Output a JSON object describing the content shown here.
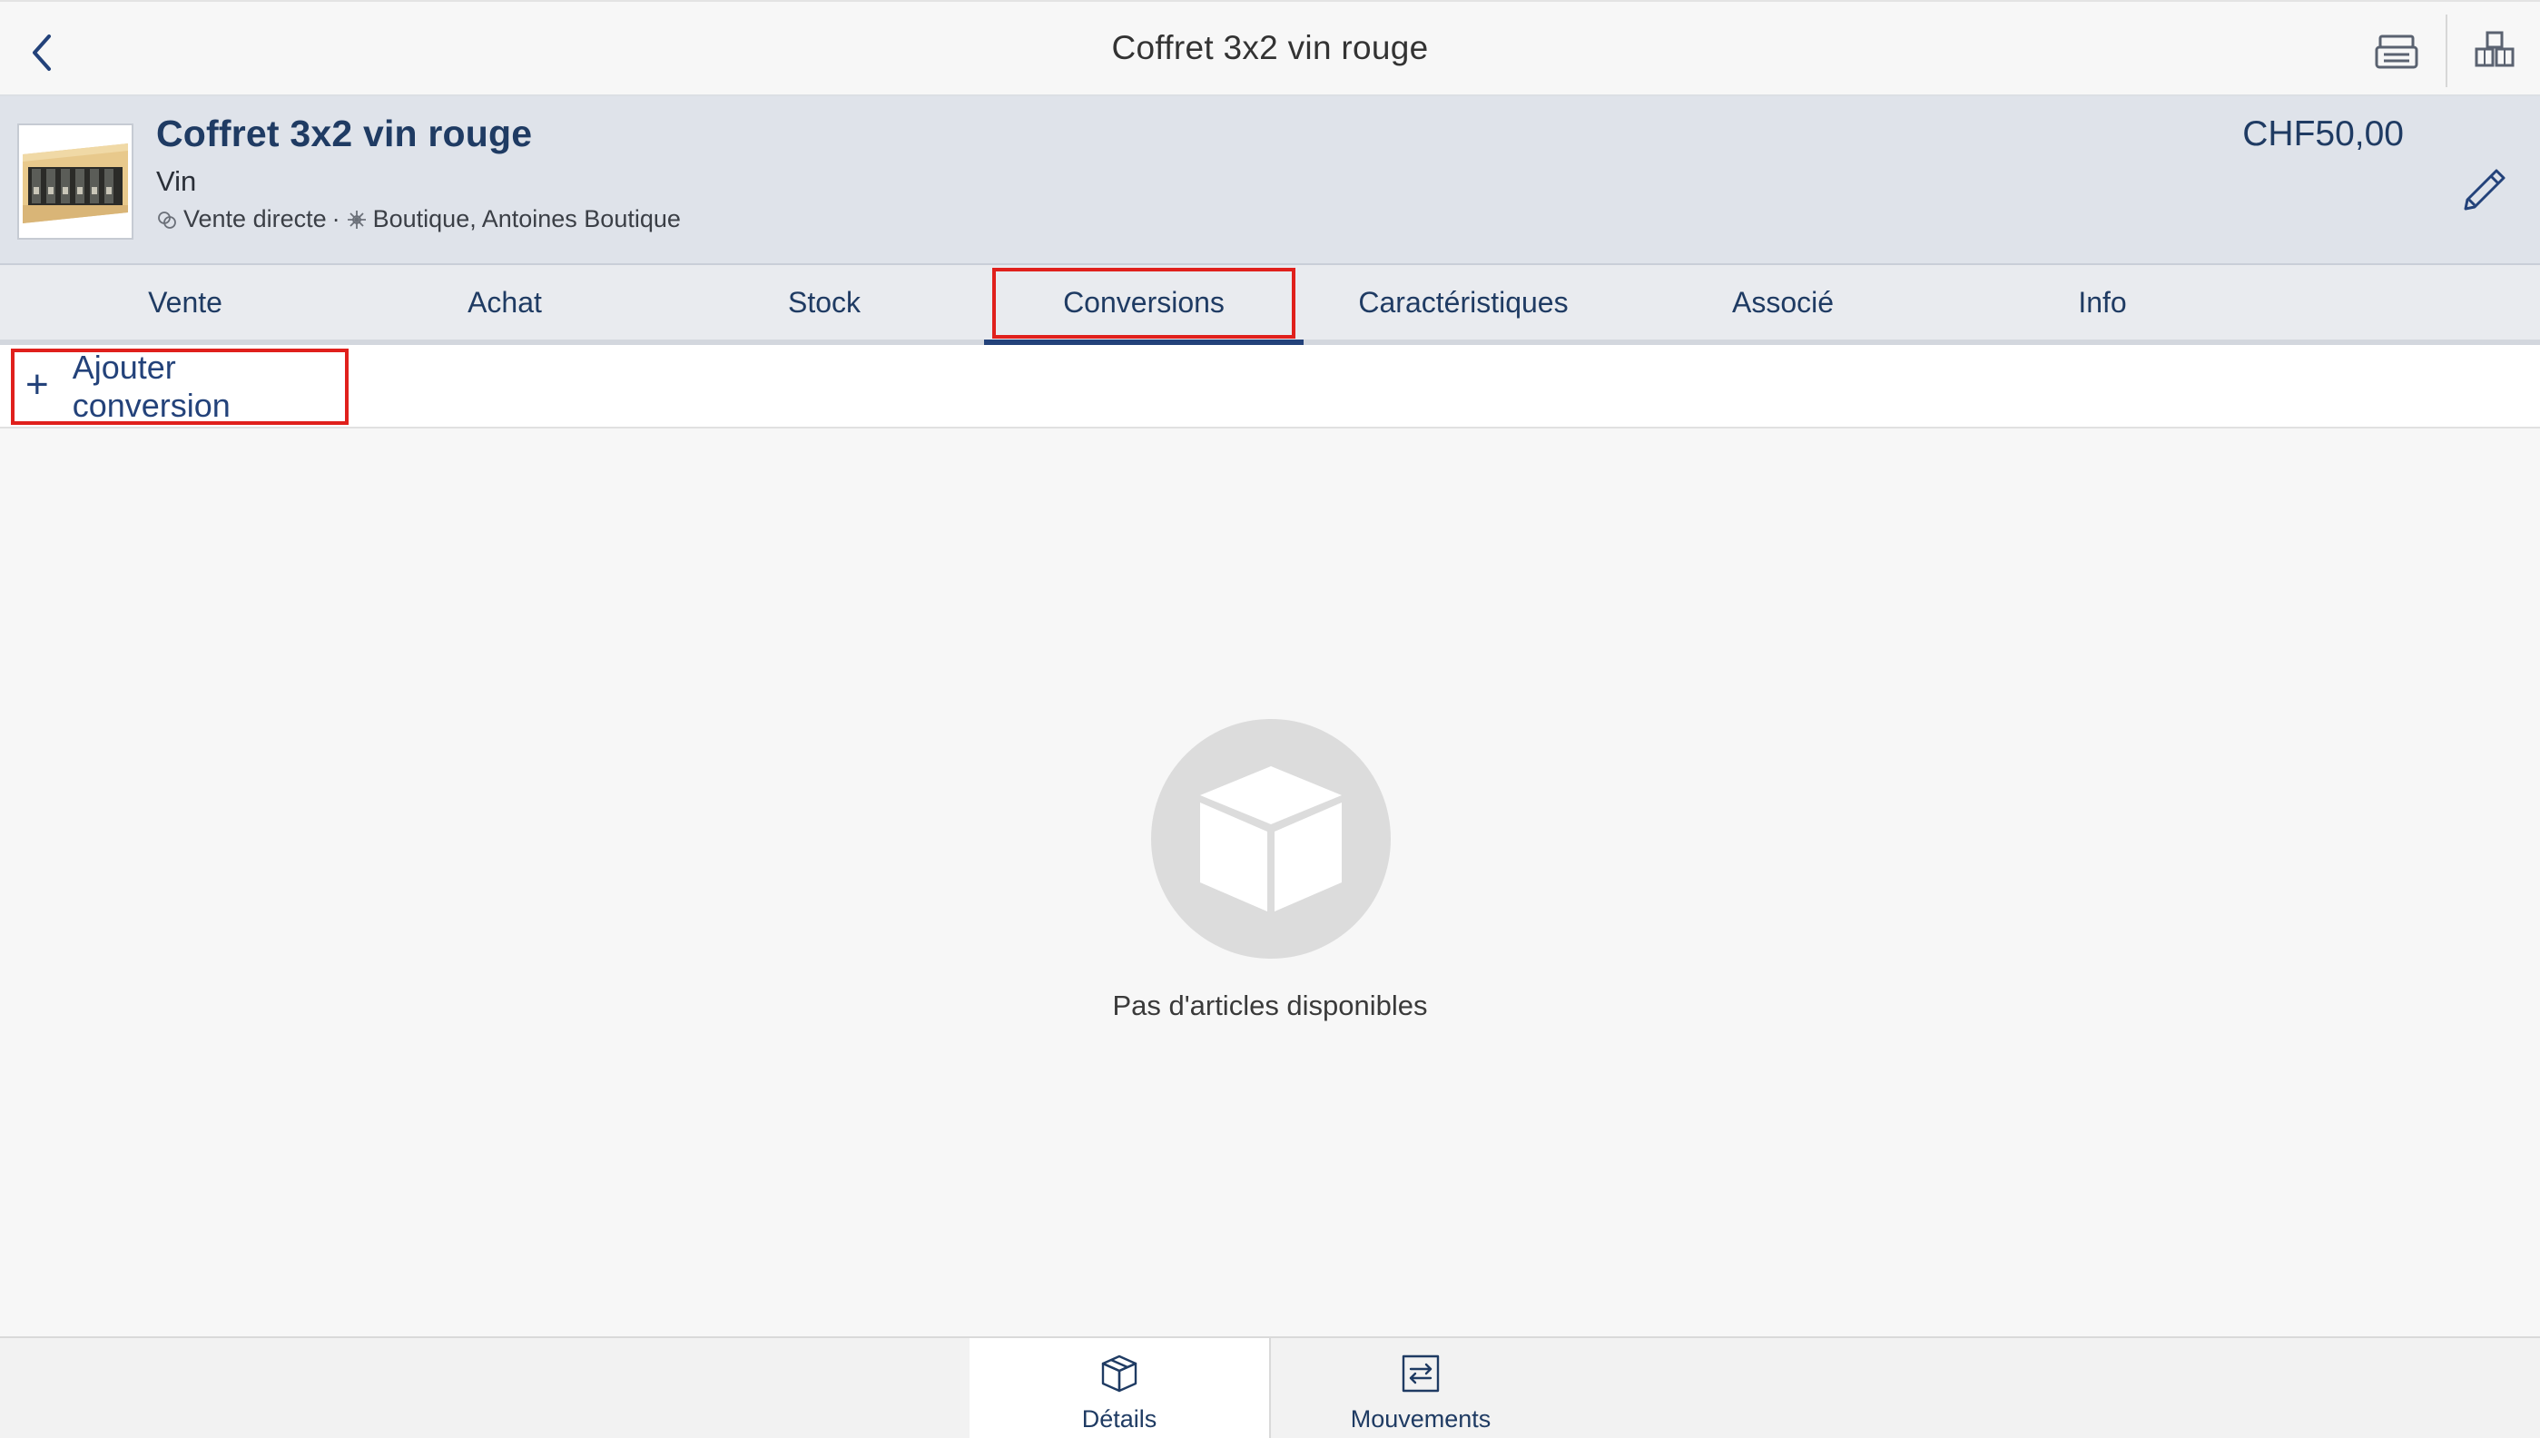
{
  "topbar": {
    "title": "Coffret 3x2 vin rouge",
    "icons": [
      "chevron-left-icon",
      "register-icon",
      "boxes-icon"
    ]
  },
  "product": {
    "name": "Coffret 3x2 vin rouge",
    "category": "Vin",
    "sale_type": "Vente directe",
    "separator": "·",
    "locations": "Boutique, Antoines Boutique",
    "price": "CHF50,00"
  },
  "tabs": [
    {
      "label": "Vente",
      "active": false
    },
    {
      "label": "Achat",
      "active": false
    },
    {
      "label": "Stock",
      "active": false
    },
    {
      "label": "Conversions",
      "active": true
    },
    {
      "label": "Caractéristiques",
      "active": false
    },
    {
      "label": "Associé",
      "active": false
    },
    {
      "label": "Info",
      "active": false
    }
  ],
  "actions": {
    "add_symbol": "+",
    "add_label": "Ajouter conversion"
  },
  "empty_state": {
    "message": "Pas d'articles disponibles",
    "icon": "cube-icon"
  },
  "bottom_nav": [
    {
      "label": "Détails",
      "icon": "box-icon",
      "active": true
    },
    {
      "label": "Mouvements",
      "icon": "transfer-icon",
      "active": false
    }
  ],
  "colors": {
    "accent": "#23427a",
    "highlight": "#e0201c",
    "header_bg": "#dfe3ea"
  }
}
